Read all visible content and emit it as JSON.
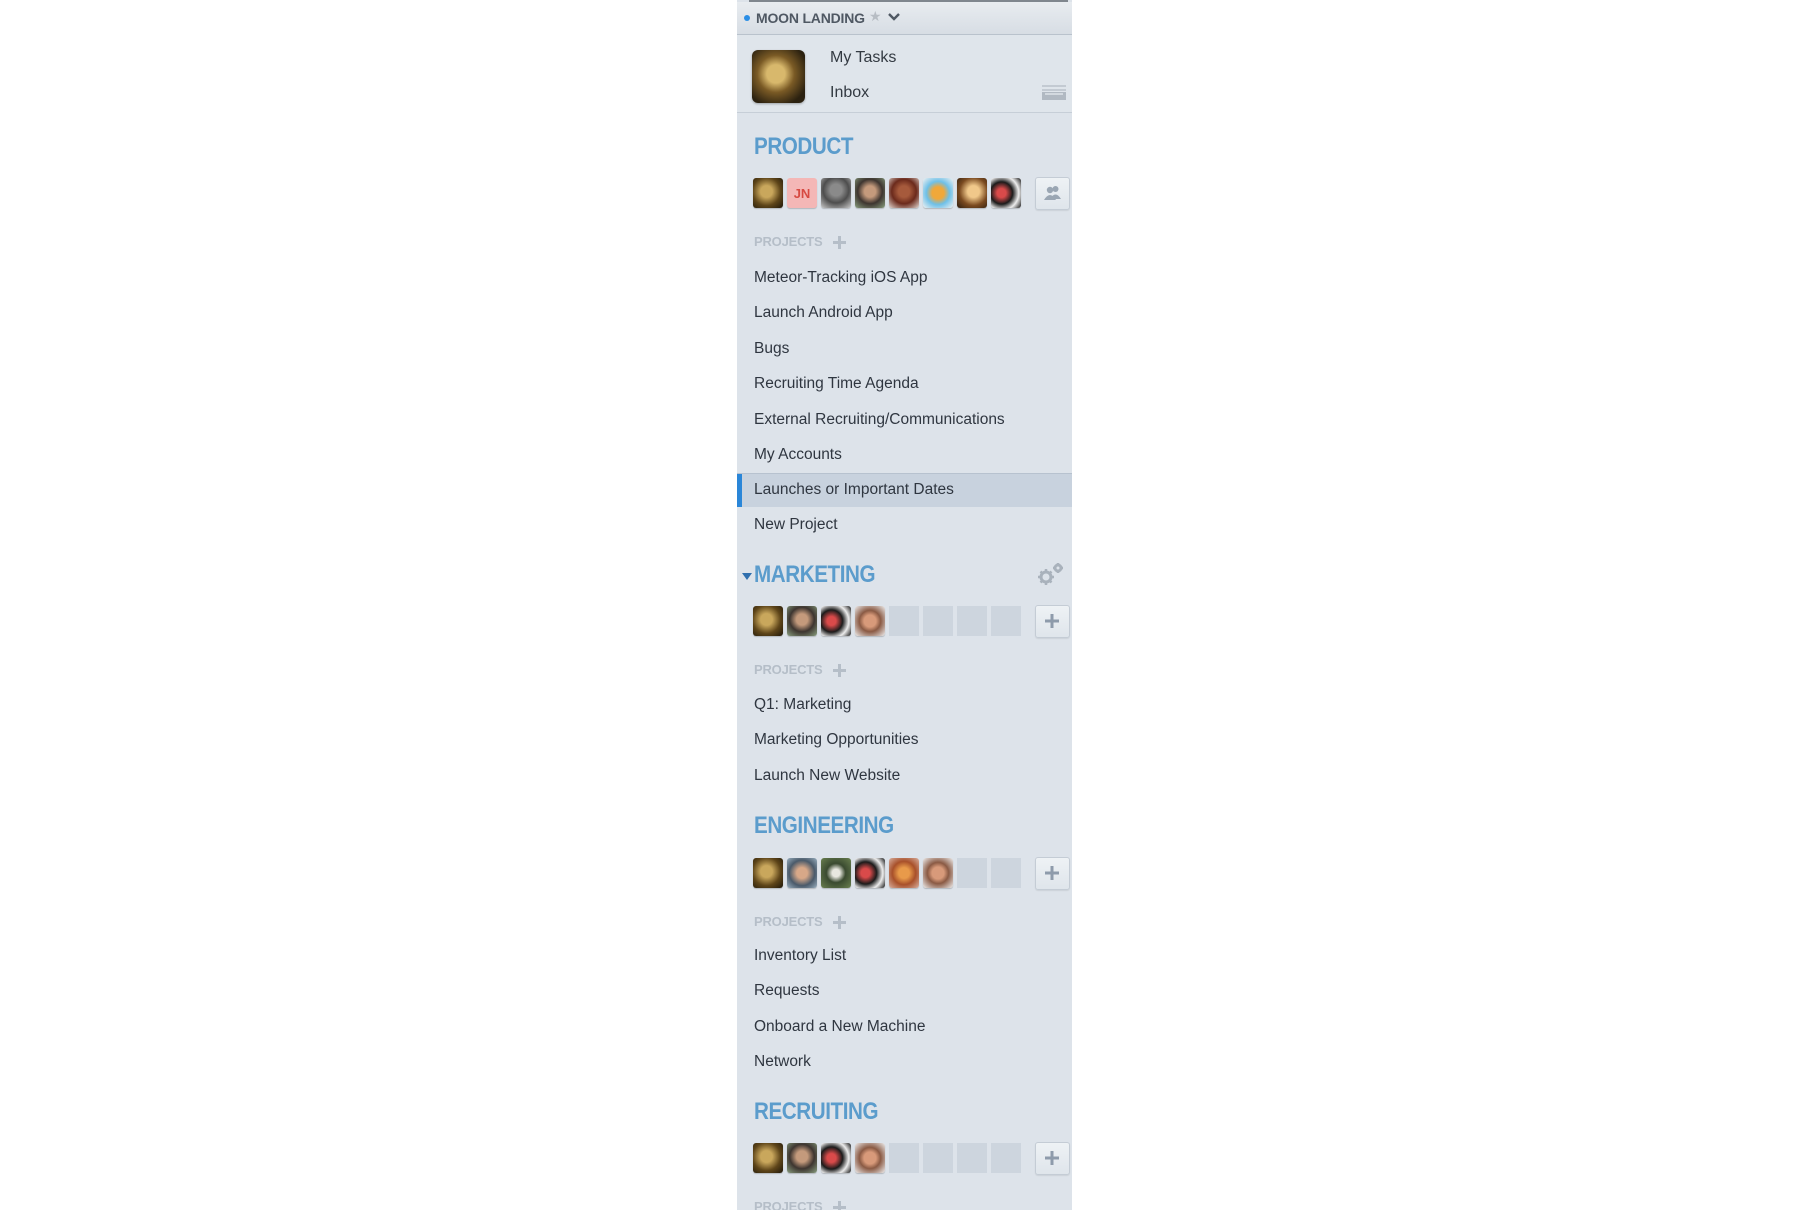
{
  "workspace": {
    "name": "MOON LANDING",
    "star_icon": "star-icon",
    "dropdown_icon": "chevron-down-icon"
  },
  "user_nav": {
    "avatar": "user-avatar",
    "my_tasks": "My Tasks",
    "inbox": "Inbox",
    "archive_icon": "inbox-tray-icon"
  },
  "teams": [
    {
      "name": "PRODUCT",
      "members_button_icon": "members-icon",
      "member_avatars": [
        "avatar",
        "JN",
        "avatar",
        "avatar",
        "avatar",
        "avatar",
        "avatar",
        "avatar"
      ],
      "empty_slots": 0,
      "projects_label": "PROJECTS",
      "projects": [
        "Meteor-Tracking iOS App",
        "Launch Android App",
        "Bugs",
        "Recruiting Time Agenda",
        "External Recruiting/Communications",
        "My Accounts",
        "Launches or Important Dates",
        "New Project"
      ],
      "selected_project": "Launches or Important Dates"
    },
    {
      "name": "MARKETING",
      "collapsible_icon": "collapse-triangle-icon",
      "settings_icon": "gear-icon",
      "members_button_icon": "plus-icon",
      "member_avatars": [
        "avatar",
        "avatar",
        "avatar",
        "avatar"
      ],
      "empty_slots": 4,
      "projects_label": "PROJECTS",
      "projects": [
        "Q1: Marketing",
        "Marketing Opportunities",
        "Launch New Website"
      ]
    },
    {
      "name": "ENGINEERING",
      "members_button_icon": "plus-icon",
      "member_avatars": [
        "avatar",
        "avatar",
        "avatar",
        "avatar",
        "avatar",
        "avatar"
      ],
      "empty_slots": 2,
      "projects_label": "PROJECTS",
      "projects": [
        "Inventory List",
        "Requests",
        "Onboard a New Machine",
        "Network"
      ]
    },
    {
      "name": "RECRUITING",
      "members_button_icon": "plus-icon",
      "member_avatars": [
        "avatar",
        "avatar",
        "avatar",
        "avatar"
      ],
      "empty_slots": 4,
      "projects_label": "PROJECTS",
      "projects": []
    }
  ],
  "colors": {
    "sidebar_bg": "#dde3ea",
    "team_title": "#5b9ccc",
    "selected_bg": "#c8d2de",
    "selected_accent": "#2a86d8",
    "workspace_dot": "#2a8ee6"
  }
}
